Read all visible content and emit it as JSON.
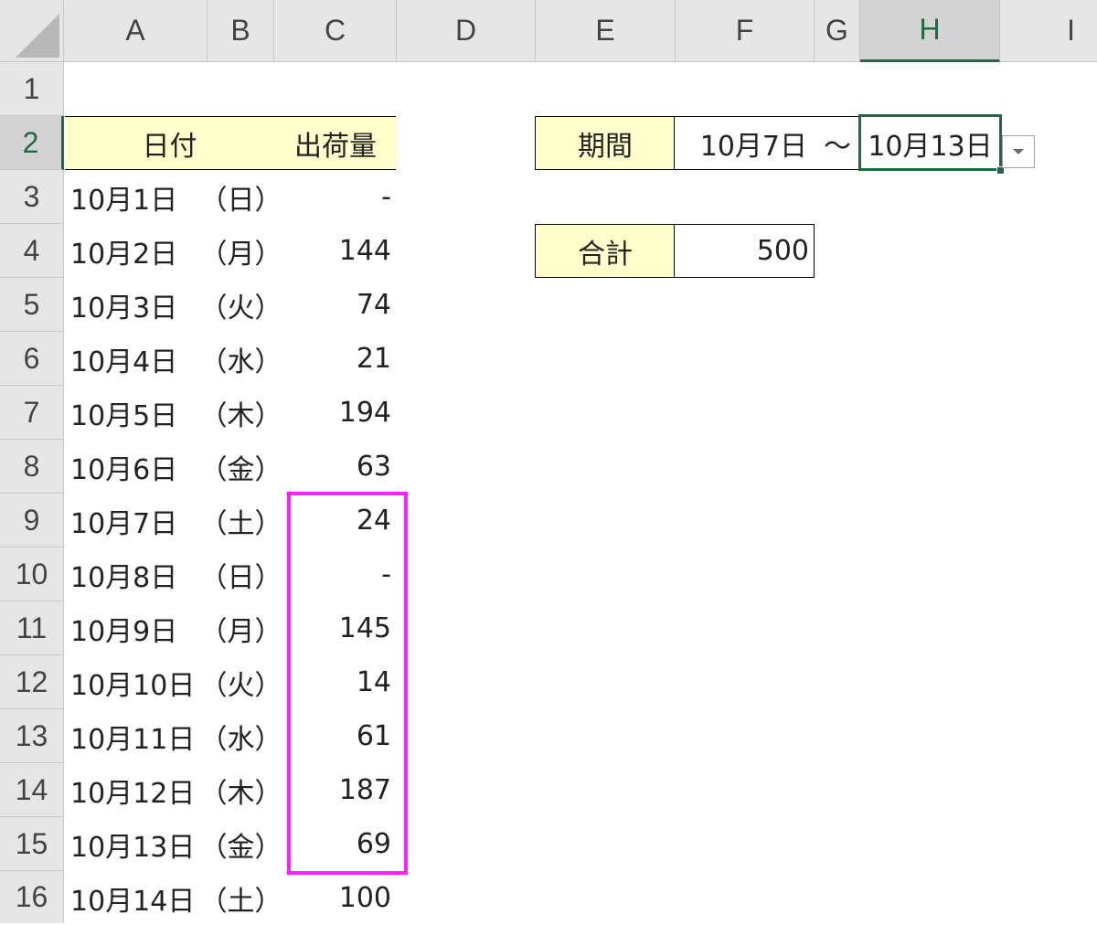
{
  "columns": [
    "A",
    "B",
    "C",
    "D",
    "E",
    "F",
    "G",
    "H",
    "I"
  ],
  "rows": [
    "1",
    "2",
    "3",
    "4",
    "5",
    "6",
    "7",
    "8",
    "9",
    "10",
    "11",
    "12",
    "13",
    "14",
    "15",
    "16"
  ],
  "selected": {
    "column": "H",
    "row": "2"
  },
  "table": {
    "header_date": "日付",
    "header_qty": "出荷量",
    "entries": [
      {
        "date": "10月1日",
        "day": "（日）",
        "qty": "-"
      },
      {
        "date": "10月2日",
        "day": "（月）",
        "qty": "144"
      },
      {
        "date": "10月3日",
        "day": "（火）",
        "qty": "74"
      },
      {
        "date": "10月4日",
        "day": "（水）",
        "qty": "21"
      },
      {
        "date": "10月5日",
        "day": "（木）",
        "qty": "194"
      },
      {
        "date": "10月6日",
        "day": "（金）",
        "qty": "63"
      },
      {
        "date": "10月7日",
        "day": "（土）",
        "qty": "24"
      },
      {
        "date": "10月8日",
        "day": "（日）",
        "qty": "-"
      },
      {
        "date": "10月9日",
        "day": "（月）",
        "qty": "145"
      },
      {
        "date": "10月10日",
        "day": "（火）",
        "qty": "14"
      },
      {
        "date": "10月11日",
        "day": "（水）",
        "qty": "61"
      },
      {
        "date": "10月12日",
        "day": "（木）",
        "qty": "187"
      },
      {
        "date": "10月13日",
        "day": "（金）",
        "qty": "69"
      },
      {
        "date": "10月14日",
        "day": "（土）",
        "qty": "100"
      }
    ]
  },
  "period": {
    "label": "期間",
    "start": "10月7日",
    "separator": "～",
    "end": "10月13日"
  },
  "total": {
    "label": "合計",
    "value": "500"
  },
  "colors": {
    "label_fill": "#ffffcc",
    "highlight": "#ff22ff",
    "selection": "#1e6b41"
  },
  "icons": {
    "dropdown": "chevron-down-icon"
  }
}
